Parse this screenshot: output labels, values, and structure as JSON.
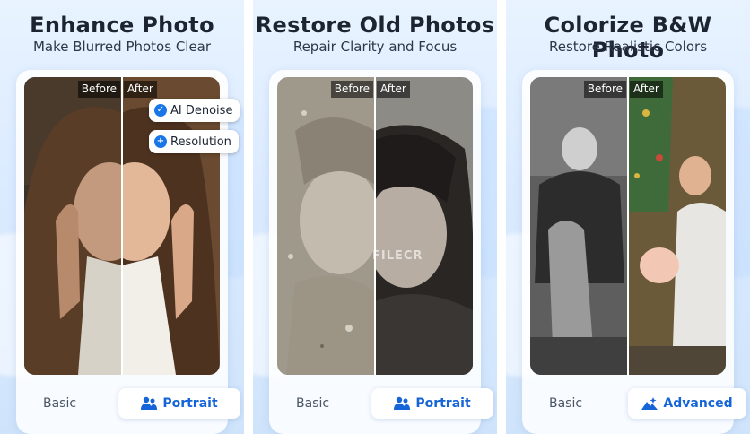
{
  "panels": [
    {
      "title": "Enhance Photo",
      "subtitle": "Make Blurred Photos Clear",
      "before_label": "Before",
      "after_label": "After",
      "features": [
        "AI Denoise",
        "Resolution"
      ],
      "mode_basic": "Basic",
      "mode_active": "Portrait",
      "mode_icon": "people-icon"
    },
    {
      "title": "Restore Old Photos",
      "subtitle": "Repair Clarity and Focus",
      "before_label": "Before",
      "after_label": "After",
      "mode_basic": "Basic",
      "mode_active": "Portrait",
      "mode_icon": "people-icon"
    },
    {
      "title": "Colorize B&W Photo",
      "subtitle": "Restore Realistic Colors",
      "before_label": "Before",
      "after_label": "After",
      "mode_basic": "Basic",
      "mode_active": "Advanced",
      "mode_icon": "mountain-sparkle-icon"
    }
  ],
  "watermark": "FILECR",
  "accent_color": "#1565d8"
}
